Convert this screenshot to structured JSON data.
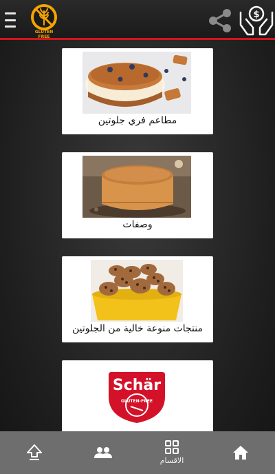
{
  "header": {
    "logo_text": "GLUTEN FREE"
  },
  "cards": [
    {
      "caption": "مطاعم فري جلوتين"
    },
    {
      "caption": "وصفات"
    },
    {
      "caption": "منتجات منوعة خالية من الجلوتين"
    },
    {
      "caption": ""
    }
  ],
  "brand_logo_text": "Schär",
  "brand_logo_subtext": "GLUTEN-FREE",
  "bottom_nav": {
    "categories_label": "الاقسام"
  },
  "colors": {
    "accent_red": "#d0161b",
    "logo_orange": "#f5a400",
    "nav_bg": "#6e6e6e"
  }
}
